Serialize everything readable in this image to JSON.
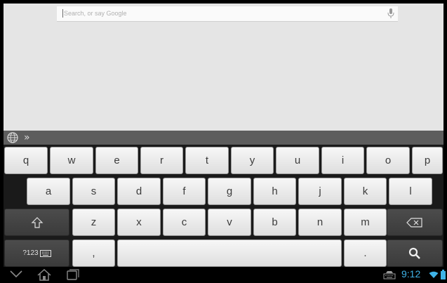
{
  "search": {
    "placeholder": "Search, or say Google"
  },
  "keyboard": {
    "suggestion_arrows": "»",
    "row1": [
      "q",
      "w",
      "e",
      "r",
      "t",
      "y",
      "u",
      "i",
      "o",
      "p"
    ],
    "row2": [
      "a",
      "s",
      "d",
      "f",
      "g",
      "h",
      "j",
      "k",
      "l"
    ],
    "row3": [
      "z",
      "x",
      "c",
      "v",
      "b",
      "n",
      "m"
    ],
    "symbols_label": "?123",
    "comma_label": ",",
    "period_label": "."
  },
  "status": {
    "time": "9:12"
  },
  "icons": [
    "globe-icon",
    "mic-icon",
    "shift-icon",
    "backspace-icon",
    "keyboard-icon",
    "search-icon",
    "back-icon",
    "home-icon",
    "recent-apps-icon",
    "ime-icon",
    "wifi-icon",
    "battery-icon"
  ],
  "colors": {
    "clock": "#3fb3e8",
    "keyboard_bg": "#1a1a1a",
    "content_bg": "#e5e5e5"
  }
}
